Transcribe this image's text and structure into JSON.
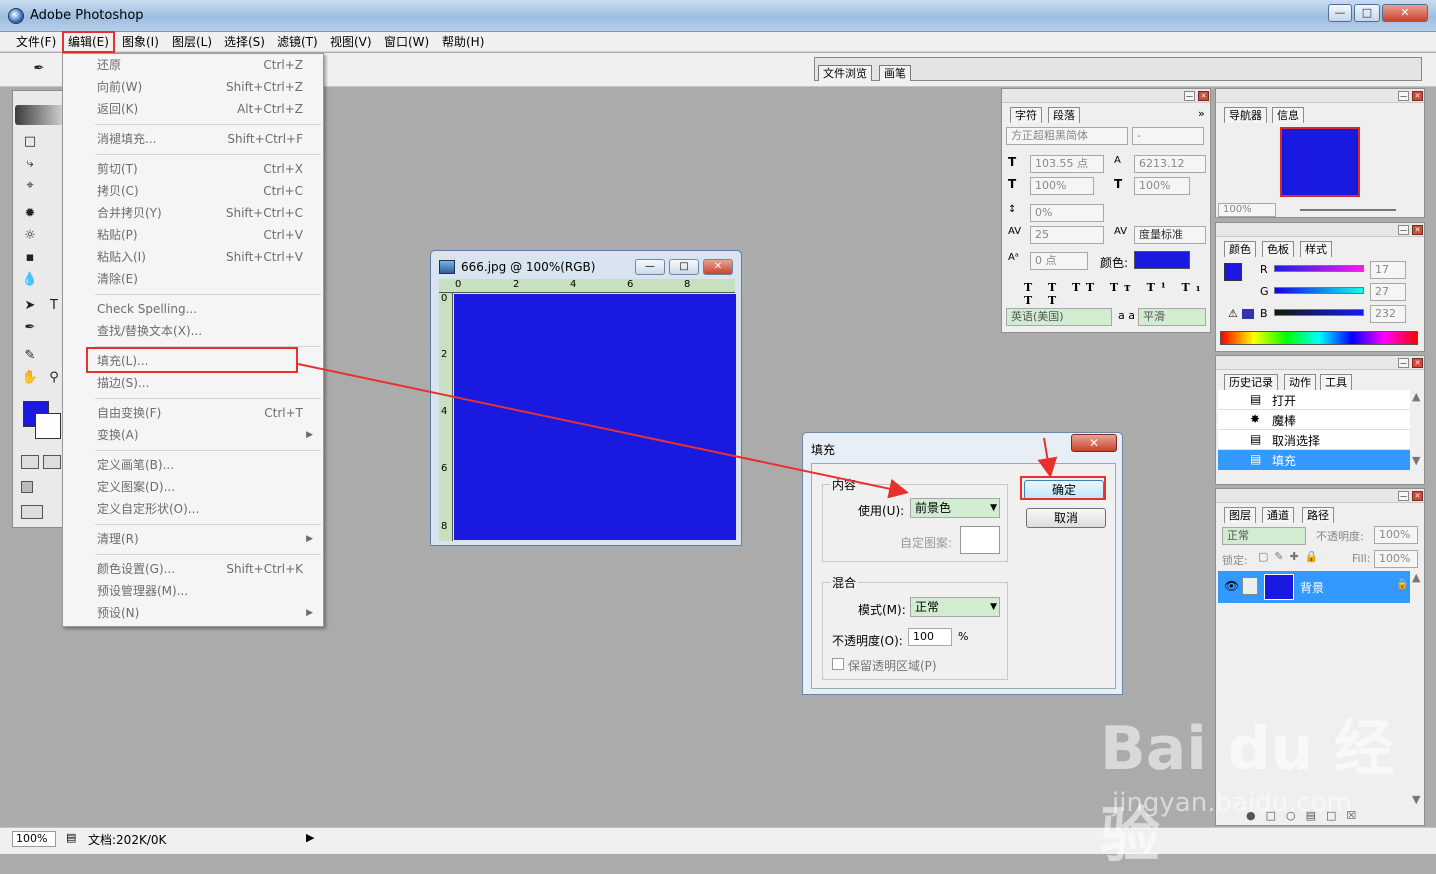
{
  "app": {
    "title": "Adobe Photoshop"
  },
  "menubar": {
    "file": "文件(F)",
    "edit": "编辑(E)",
    "image": "图象(I)",
    "layer": "图层(L)",
    "select": "选择(S)",
    "filter": "滤镜(T)",
    "view": "视图(V)",
    "window": "窗口(W)",
    "help": "帮助(H)"
  },
  "palette_well": {
    "tab1": "文件浏览",
    "tab2": "画笔"
  },
  "edit_menu": {
    "items": [
      {
        "label": "还原",
        "shortcut": "Ctrl+Z"
      },
      {
        "label": "向前(W)",
        "shortcut": "Shift+Ctrl+Z"
      },
      {
        "label": "返回(K)",
        "shortcut": "Alt+Ctrl+Z"
      },
      {
        "label": "消褪填充...",
        "shortcut": "Shift+Ctrl+F"
      },
      {
        "label": "剪切(T)",
        "shortcut": "Ctrl+X"
      },
      {
        "label": "拷贝(C)",
        "shortcut": "Ctrl+C"
      },
      {
        "label": "合并拷贝(Y)",
        "shortcut": "Shift+Ctrl+C"
      },
      {
        "label": "粘贴(P)",
        "shortcut": "Ctrl+V"
      },
      {
        "label": "粘贴入(I)",
        "shortcut": "Shift+Ctrl+V"
      },
      {
        "label": "清除(E)",
        "shortcut": ""
      },
      {
        "label": "Check Spelling...",
        "shortcut": ""
      },
      {
        "label": "查找/替换文本(X)...",
        "shortcut": ""
      },
      {
        "label": "填充(L)...",
        "shortcut": ""
      },
      {
        "label": "描边(S)...",
        "shortcut": ""
      },
      {
        "label": "自由变换(F)",
        "shortcut": "Ctrl+T"
      },
      {
        "label": "变换(A)",
        "shortcut": ""
      },
      {
        "label": "定义画笔(B)...",
        "shortcut": ""
      },
      {
        "label": "定义图案(D)...",
        "shortcut": ""
      },
      {
        "label": "定义自定形状(O)...",
        "shortcut": ""
      },
      {
        "label": "清理(R)",
        "shortcut": ""
      },
      {
        "label": "颜色设置(G)...",
        "shortcut": "Shift+Ctrl+K"
      },
      {
        "label": "预设管理器(M)...",
        "shortcut": ""
      },
      {
        "label": "预设(N)",
        "shortcut": ""
      }
    ]
  },
  "document": {
    "title": "666.jpg @ 100%(RGB)",
    "ruler_top": [
      "0",
      "2",
      "4",
      "6",
      "8"
    ],
    "ruler_left": [
      "0",
      "2",
      "4",
      "6",
      "8"
    ],
    "fill_color": "#1919e0"
  },
  "fill_dialog": {
    "title": "填充",
    "content_group": "内容",
    "use_label": "使用(U):",
    "use_value": "前景色",
    "custom_pattern_label": "自定图案:",
    "blend_group": "混合",
    "mode_label": "模式(M):",
    "mode_value": "正常",
    "opacity_label": "不透明度(O):",
    "opacity_value": "100",
    "opacity_unit": "%",
    "preserve_label": "保留透明区域(P)",
    "ok": "确定",
    "cancel": "取消"
  },
  "character_panel": {
    "tab1": "字符",
    "tab2": "段落",
    "font_family": "方正超粗黑简体",
    "font_style": "-",
    "font_size": "103.55 点",
    "leading": "6213.12",
    "vscale": "100%",
    "hscale": "100%",
    "baseline": "0%",
    "tracking": "25",
    "kerning": "度量标准",
    "baseline_shift": "0 点",
    "color_label": "颜色:",
    "language": "英语(美国)",
    "aa_label": "a a",
    "antialias": "平滑",
    "color": "#1919e0"
  },
  "navigator_panel": {
    "tab1": "导航器",
    "tab2": "信息",
    "zoom": "100%"
  },
  "color_panel": {
    "tab1": "颜色",
    "tab2": "色板",
    "tab3": "样式",
    "r_label": "R",
    "g_label": "G",
    "b_label": "B",
    "r": "17",
    "g": "27",
    "b": "232",
    "fg_color": "#1919e0"
  },
  "history_panel": {
    "tab1": "历史记录",
    "tab2": "动作",
    "tab3": "工具",
    "items": [
      "打开",
      "魔棒",
      "取消选择",
      "填充"
    ]
  },
  "layers_panel": {
    "tab1": "图层",
    "tab2": "通道",
    "tab3": "路径",
    "blend_mode": "正常",
    "opacity_label": "不透明度:",
    "opacity": "100%",
    "lock_label": "锁定:",
    "fill_label": "Fill:",
    "fill": "100%",
    "layer_name": "背景"
  },
  "status": {
    "zoom": "100%",
    "doc": "文档:202K/0K"
  },
  "watermark": {
    "brand": "Bai du 经验",
    "url": "jingyan.baidu.com"
  }
}
